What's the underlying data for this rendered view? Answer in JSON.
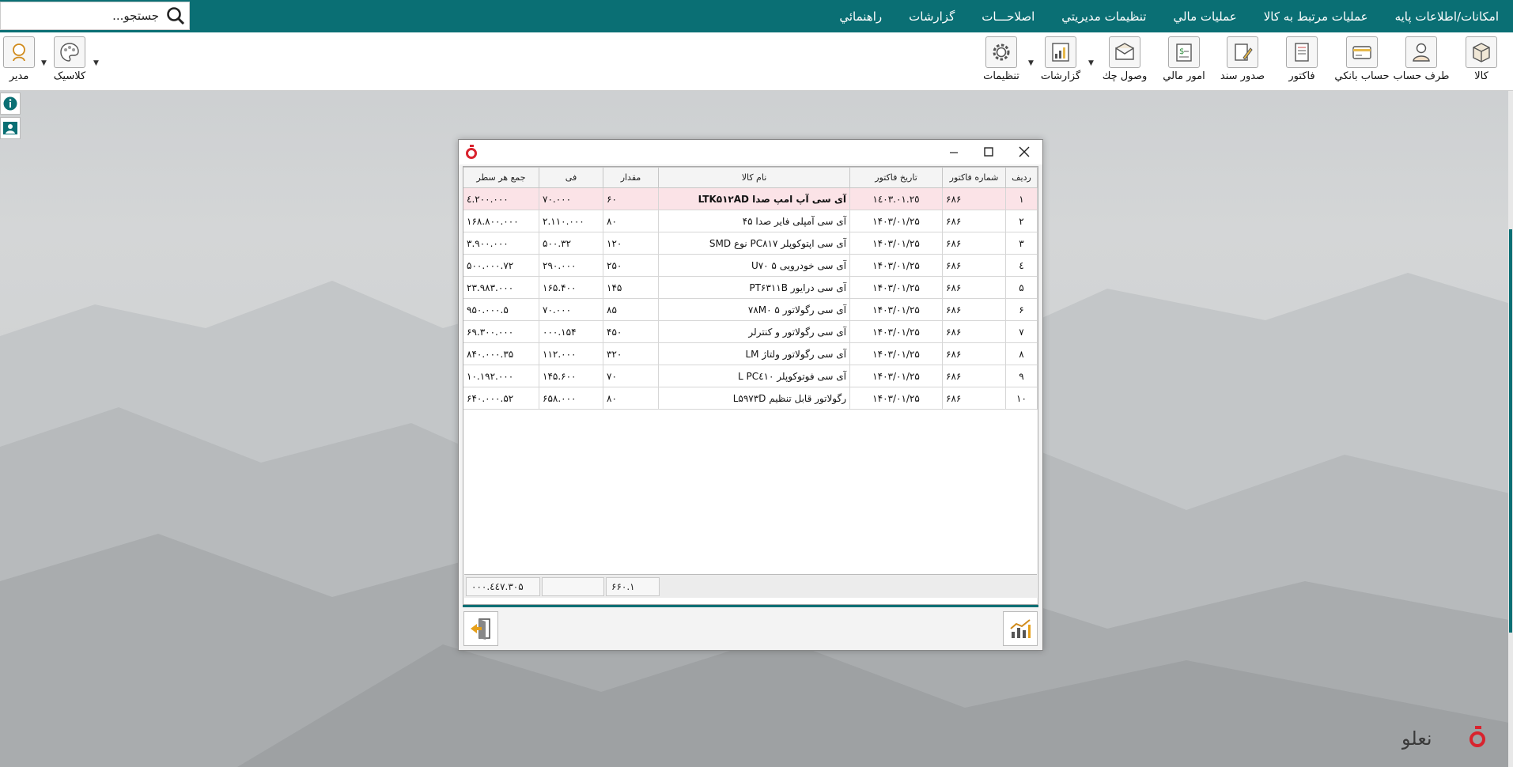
{
  "menubar": {
    "items": [
      "امکانات/اطلاعات پایه",
      "عملیات مرتبط به کالا",
      "عملیات مالي",
      "تنظیمات مدیریتي",
      "اصلاحـــات",
      "گزارشات",
      "راهنمائي"
    ],
    "search_placeholder": "جستجو..."
  },
  "toolbar": {
    "buttons": [
      {
        "label": "کالا",
        "icon": "box-icon"
      },
      {
        "label": "طرف حساب",
        "icon": "user-icon"
      },
      {
        "label": "حساب بانکي",
        "icon": "bank-card-icon"
      },
      {
        "label": "فاکتور",
        "icon": "invoice-icon"
      },
      {
        "label": "صدور سند",
        "icon": "document-edit-icon"
      },
      {
        "label": "امور مالي",
        "icon": "money-icon"
      },
      {
        "label": "وصول چك",
        "icon": "cheque-icon"
      },
      {
        "label": "گزارشات",
        "icon": "report-chart-icon"
      },
      {
        "label": "تنظیمات",
        "icon": "gear-icon"
      }
    ],
    "left_buttons": [
      {
        "label": "کلاسیک",
        "icon": "palette-icon"
      },
      {
        "label": "مدیر",
        "icon": "admin-user-icon"
      }
    ]
  },
  "side_icons": [
    "info-icon",
    "contact-card-icon"
  ],
  "dialog": {
    "columns": [
      "ردیف",
      "شماره فاکتور",
      "تاریخ فاکتور",
      "نام کالا",
      "مقدار",
      "فی",
      "جمع هر سطر"
    ],
    "rows": [
      [
        "١",
        "۶٨۶",
        "١٤٠٣.٠١.٢٥",
        "آی سی آپ امپ صدا LTK۵۱۲AD",
        "۶٠",
        "٧٠.٠٠٠",
        "٤.٢٠٠.٠٠٠"
      ],
      [
        "٢",
        "۶٨۶",
        "۱۴۰۳/۰۱/۲۵",
        "آی سی آمپلی فایر صدا ۴۵",
        "٨٠",
        "٢.١١٠.٠٠٠",
        "١۶٨.٨٠٠.٠٠٠"
      ],
      [
        "٣",
        "۶٨۶",
        "۱۴۰۳/۰۱/۲۵",
        "آی سی اپتوکوپلر PC۸۱۷ نوع SMD",
        "١٢٠",
        "٣٢.۵٠٠",
        "٣.٩٠٠.٠٠٠"
      ],
      [
        "٤",
        "۶٨۶",
        "۱۴۰۳/۰۱/۲۵",
        "آی سی خودرویی U۷۰ ۵",
        "٢۵٠",
        "٢٩٠.٠٠٠",
        "٧٢.۵٠٠.٠٠٠"
      ],
      [
        "۵",
        "۶٨۶",
        "۱۴۰۳/۰۱/۲۵",
        "آی سی درایور PT۶۳۱۱B",
        "١۴۵",
        "١۶۵.۴٠٠",
        "٢٣.٩٨٣.٠٠٠"
      ],
      [
        "۶",
        "۶٨۶",
        "۱۴۰۳/۰۱/۲۵",
        "آی سی رگولاتور ۵ ۷۸M۰",
        "٨۵",
        "٧٠.٠٠٠",
        "۵.٩۵٠.٠٠٠"
      ],
      [
        "٧",
        "۶٨۶",
        "۱۴۰۳/۰۱/۲۵",
        "آی سی رگولاتور و کنترلر",
        "۴۵٠",
        "١۵۴.٠٠٠",
        "۶٩.٣٠٠.٠٠٠"
      ],
      [
        "٨",
        "۶٨۶",
        "۱۴۰۳/۰۱/۲۵",
        "آی سی رگولاتور ولتاژ LM",
        "٣٢٠",
        "١١٢.٠٠٠",
        "٣۵.٨۴٠.٠٠٠"
      ],
      [
        "٩",
        "۶٨۶",
        "۱۴۰۳/۰۱/۲۵",
        "آی سی فوتوکوپلر PC٤١٠ L",
        "٧٠",
        "١۴۵.۶٠٠",
        "١٠.١٩٢.٠٠٠"
      ],
      [
        "١٠",
        "۶٨۶",
        "۱۴۰۳/۰۱/۲۵",
        "رگولاتور قابل تنظیم L۵۹۷۳D",
        "٨٠",
        "۶۵٨.٠٠٠",
        "۵٢.۶۴٠.٠٠٠"
      ]
    ],
    "total_quantity": "١.۶۶٠",
    "total_sum": "٤٤٧.٣٠۵.٠٠٠"
  },
  "brand": {
    "logo_text": "نعلو",
    "accent_color": "#d9232e"
  },
  "colors": {
    "teal": "#0a6f74",
    "selected_row": "#fbe3e7"
  }
}
